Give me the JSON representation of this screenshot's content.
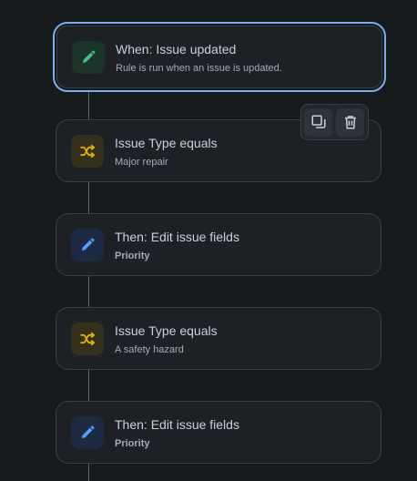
{
  "rules": [
    {
      "title": "When: Issue updated",
      "subtitle": "Rule is run when an issue is updated.",
      "icon": "pencil-icon",
      "color": "#3fbf83"
    },
    {
      "title": "Issue Type equals",
      "subtitle": "Major repair",
      "icon": "shuffle-icon",
      "color": "#e2b203"
    },
    {
      "title": "Then: Edit issue fields",
      "subtitle": "Priority",
      "icon": "pencil-icon",
      "color": "#579dff"
    },
    {
      "title": "Issue Type equals",
      "subtitle": "A safety hazard",
      "icon": "shuffle-icon",
      "color": "#e2b203"
    },
    {
      "title": "Then: Edit issue fields",
      "subtitle": "Priority",
      "icon": "pencil-icon",
      "color": "#579dff"
    }
  ],
  "toolbar": {
    "duplicate_icon": "duplicate-icon",
    "delete_icon": "trash-icon"
  },
  "colors": {
    "background": "#161a1d",
    "card": "#1d2125",
    "selected_border": "#7cacf0"
  }
}
